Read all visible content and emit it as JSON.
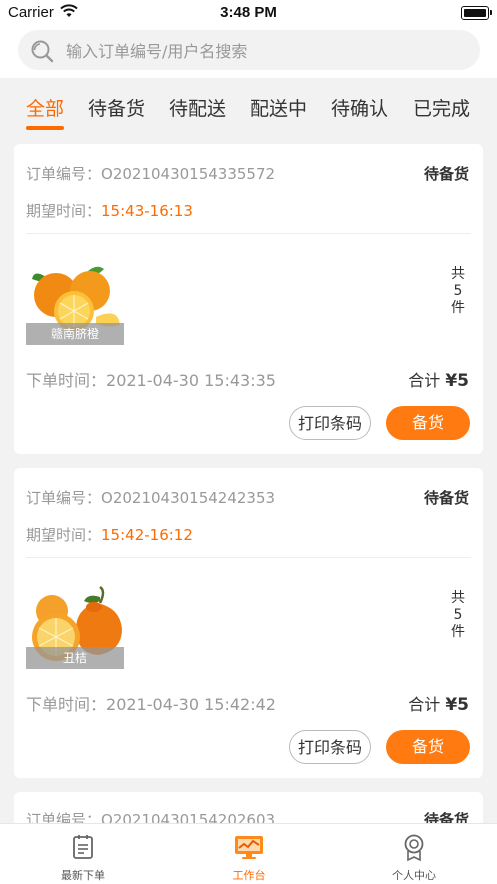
{
  "status_bar": {
    "carrier": "Carrier",
    "time": "3:48 PM"
  },
  "search": {
    "placeholder": "输入订单编号/用户名搜索",
    "value": ""
  },
  "tabs": [
    {
      "label": "全部",
      "active": true
    },
    {
      "label": "待备货",
      "active": false
    },
    {
      "label": "待配送",
      "active": false
    },
    {
      "label": "配送中",
      "active": false
    },
    {
      "label": "待确认",
      "active": false
    },
    {
      "label": "已完成",
      "active": false
    }
  ],
  "orders": [
    {
      "order_no_label": "订单编号：",
      "order_no": "O20210430154335572",
      "status": "待备货",
      "expect_label": "期望时间：",
      "expect_time": "15:43-16:13",
      "product_name": "赣南脐橙",
      "qty_text": "共5件",
      "order_time_label": "下单时间：",
      "order_time": "2021-04-30 15:43:35",
      "total_label": "合计",
      "total": "¥5",
      "print_btn": "打印条码",
      "stock_btn": "备货"
    },
    {
      "order_no_label": "订单编号：",
      "order_no": "O20210430154242353",
      "status": "待备货",
      "expect_label": "期望时间：",
      "expect_time": "15:42-16:12",
      "product_name": "丑桔",
      "qty_text": "共5件",
      "order_time_label": "下单时间：",
      "order_time": "2021-04-30 15:42:42",
      "total_label": "合计",
      "total": "¥5",
      "print_btn": "打印条码",
      "stock_btn": "备货"
    },
    {
      "order_no_label": "订单编号：",
      "order_no": "O20210430154202603",
      "status": "待备货"
    }
  ],
  "bottom_tabs": [
    {
      "label": "最新下单",
      "icon": "clipboard-icon",
      "active": false
    },
    {
      "label": "工作台",
      "icon": "monitor-chart-icon",
      "active": true
    },
    {
      "label": "个人中心",
      "icon": "user-badge-icon",
      "active": false
    }
  ],
  "colors": {
    "accent": "#ff6a00",
    "button": "#ff7a10"
  }
}
